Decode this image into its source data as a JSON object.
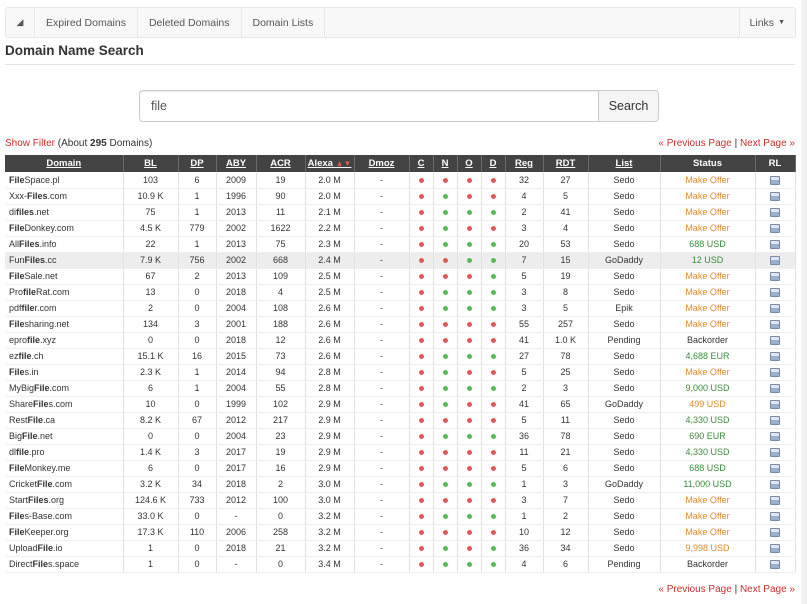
{
  "nav": {
    "home_icon": "home-icon",
    "links": [
      "Expired Domains",
      "Deleted Domains",
      "Domain Lists"
    ],
    "menu_label": "Links",
    "menu_caret": "▼"
  },
  "page_title": "Domain Name Search",
  "search": {
    "value": "file",
    "button": "Search"
  },
  "filter": {
    "show_filter": "Show Filter",
    "about_prefix": "(About",
    "count": "295",
    "about_suffix": "Domains)"
  },
  "pager": {
    "prev": "« Previous Page",
    "sep": "|",
    "next": "Next Page »"
  },
  "columns": [
    "Domain",
    "BL",
    "DP",
    "ABY",
    "ACR",
    "Alexa",
    "Dmoz",
    "C",
    "N",
    "O",
    "D",
    "Reg",
    "RDT",
    "List",
    "Status",
    "RL"
  ],
  "sort_indicator": "▲▼",
  "colors": {
    "header_bg": "#434343",
    "dot_red": "#e05b55",
    "dot_green": "#5cb85c",
    "status_orange": "#e08a2c",
    "status_green": "#3c8a3c",
    "link_red": "#c9302c"
  },
  "rows": [
    {
      "pre": "",
      "bold": "File",
      "post": "Space.pl",
      "bl": "103",
      "dp": "6",
      "aby": "2009",
      "acr": "19",
      "alexa": "2.0 M",
      "dmoz": "-",
      "c": "r",
      "n": "r",
      "o": "r",
      "d": "r",
      "reg": "32",
      "rdt": "27",
      "list": "Sedo",
      "status": "Make Offer",
      "sc": "orange"
    },
    {
      "pre": "Xxx-",
      "bold": "Files",
      "post": ".com",
      "bl": "10.9 K",
      "dp": "1",
      "aby": "1996",
      "acr": "90",
      "alexa": "2.0 M",
      "dmoz": "-",
      "c": "r",
      "n": "g",
      "o": "r",
      "d": "r",
      "reg": "4",
      "rdt": "5",
      "list": "Sedo",
      "status": "Make Offer",
      "sc": "orange"
    },
    {
      "pre": "di",
      "bold": "files",
      "post": ".net",
      "bl": "75",
      "dp": "1",
      "aby": "2013",
      "acr": "11",
      "alexa": "2.1 M",
      "dmoz": "-",
      "c": "r",
      "n": "g",
      "o": "g",
      "d": "g",
      "reg": "2",
      "rdt": "41",
      "list": "Sedo",
      "status": "Make Offer",
      "sc": "orange"
    },
    {
      "pre": "",
      "bold": "File",
      "post": "Donkey.com",
      "bl": "4.5 K",
      "dp": "779",
      "aby": "2002",
      "acr": "1622",
      "alexa": "2.2 M",
      "dmoz": "-",
      "c": "r",
      "n": "g",
      "o": "r",
      "d": "r",
      "reg": "3",
      "rdt": "4",
      "list": "Sedo",
      "status": "Make Offer",
      "sc": "orange"
    },
    {
      "pre": "All",
      "bold": "Files",
      "post": ".info",
      "bl": "22",
      "dp": "1",
      "aby": "2013",
      "acr": "75",
      "alexa": "2.3 M",
      "dmoz": "-",
      "c": "r",
      "n": "g",
      "o": "g",
      "d": "g",
      "reg": "20",
      "rdt": "53",
      "list": "Sedo",
      "status": "688 USD",
      "sc": "green"
    },
    {
      "pre": "Fun",
      "bold": "Files",
      "post": ".cc",
      "bl": "7.9 K",
      "dp": "756",
      "aby": "2002",
      "acr": "668",
      "alexa": "2.4 M",
      "dmoz": "-",
      "c": "r",
      "n": "r",
      "o": "g",
      "d": "g",
      "reg": "7",
      "rdt": "15",
      "list": "GoDaddy",
      "status": "12 USD",
      "sc": "green",
      "hl": true
    },
    {
      "pre": "",
      "bold": "File",
      "post": "Sale.net",
      "bl": "67",
      "dp": "2",
      "aby": "2013",
      "acr": "109",
      "alexa": "2.5 M",
      "dmoz": "-",
      "c": "r",
      "n": "r",
      "o": "r",
      "d": "g",
      "reg": "5",
      "rdt": "19",
      "list": "Sedo",
      "status": "Make Offer",
      "sc": "orange"
    },
    {
      "pre": "Pro",
      "bold": "file",
      "post": "Rat.com",
      "bl": "13",
      "dp": "0",
      "aby": "2018",
      "acr": "4",
      "alexa": "2.5 M",
      "dmoz": "-",
      "c": "r",
      "n": "g",
      "o": "g",
      "d": "g",
      "reg": "3",
      "rdt": "8",
      "list": "Sedo",
      "status": "Make Offer",
      "sc": "orange"
    },
    {
      "pre": "pdf",
      "bold": "file",
      "post": "r.com",
      "bl": "2",
      "dp": "0",
      "aby": "2004",
      "acr": "108",
      "alexa": "2.6 M",
      "dmoz": "-",
      "c": "r",
      "n": "g",
      "o": "g",
      "d": "g",
      "reg": "3",
      "rdt": "5",
      "list": "Epik",
      "status": "Make Offer",
      "sc": "orange"
    },
    {
      "pre": "",
      "bold": "File",
      "post": "sharing.net",
      "bl": "134",
      "dp": "3",
      "aby": "2001",
      "acr": "188",
      "alexa": "2.6 M",
      "dmoz": "-",
      "c": "r",
      "n": "r",
      "o": "r",
      "d": "r",
      "reg": "55",
      "rdt": "257",
      "list": "Sedo",
      "status": "Make Offer",
      "sc": "orange"
    },
    {
      "pre": "epro",
      "bold": "file",
      "post": ".xyz",
      "bl": "0",
      "dp": "0",
      "aby": "2018",
      "acr": "12",
      "alexa": "2.6 M",
      "dmoz": "-",
      "c": "r",
      "n": "r",
      "o": "r",
      "d": "r",
      "reg": "41",
      "rdt": "1.0 K",
      "list": "Pending",
      "status": "Backorder",
      "sc": "dark"
    },
    {
      "pre": "ez",
      "bold": "file",
      "post": ".ch",
      "bl": "15.1 K",
      "dp": "16",
      "aby": "2015",
      "acr": "73",
      "alexa": "2.6 M",
      "dmoz": "-",
      "c": "r",
      "n": "g",
      "o": "g",
      "d": "g",
      "reg": "27",
      "rdt": "78",
      "list": "Sedo",
      "status": "4,688 EUR",
      "sc": "green"
    },
    {
      "pre": "",
      "bold": "File",
      "post": "s.in",
      "bl": "2.3 K",
      "dp": "1",
      "aby": "2014",
      "acr": "94",
      "alexa": "2.8 M",
      "dmoz": "-",
      "c": "r",
      "n": "g",
      "o": "r",
      "d": "r",
      "reg": "5",
      "rdt": "25",
      "list": "Sedo",
      "status": "Make Offer",
      "sc": "orange"
    },
    {
      "pre": "MyBig",
      "bold": "File",
      "post": ".com",
      "bl": "6",
      "dp": "1",
      "aby": "2004",
      "acr": "55",
      "alexa": "2.8 M",
      "dmoz": "-",
      "c": "r",
      "n": "g",
      "o": "g",
      "d": "g",
      "reg": "2",
      "rdt": "3",
      "list": "Sedo",
      "status": "9,000 USD",
      "sc": "green"
    },
    {
      "pre": "Share",
      "bold": "File",
      "post": "s.com",
      "bl": "10",
      "dp": "0",
      "aby": "1999",
      "acr": "102",
      "alexa": "2.9 M",
      "dmoz": "-",
      "c": "r",
      "n": "g",
      "o": "r",
      "d": "r",
      "reg": "41",
      "rdt": "65",
      "list": "GoDaddy",
      "status": "499 USD",
      "sc": "orange"
    },
    {
      "pre": "Rest",
      "bold": "File",
      "post": ".ca",
      "bl": "8.2 K",
      "dp": "67",
      "aby": "2012",
      "acr": "217",
      "alexa": "2.9 M",
      "dmoz": "-",
      "c": "r",
      "n": "r",
      "o": "r",
      "d": "r",
      "reg": "5",
      "rdt": "11",
      "list": "Sedo",
      "status": "4,330 USD",
      "sc": "green"
    },
    {
      "pre": "Big",
      "bold": "File",
      "post": ".net",
      "bl": "0",
      "dp": "0",
      "aby": "2004",
      "acr": "23",
      "alexa": "2.9 M",
      "dmoz": "-",
      "c": "r",
      "n": "g",
      "o": "g",
      "d": "g",
      "reg": "36",
      "rdt": "78",
      "list": "Sedo",
      "status": "690 EUR",
      "sc": "green"
    },
    {
      "pre": "dl",
      "bold": "file",
      "post": ".pro",
      "bl": "1.4 K",
      "dp": "3",
      "aby": "2017",
      "acr": "19",
      "alexa": "2.9 M",
      "dmoz": "-",
      "c": "r",
      "n": "r",
      "o": "r",
      "d": "r",
      "reg": "11",
      "rdt": "21",
      "list": "Sedo",
      "status": "4,330 USD",
      "sc": "green"
    },
    {
      "pre": "",
      "bold": "File",
      "post": "Monkey.me",
      "bl": "6",
      "dp": "0",
      "aby": "2017",
      "acr": "16",
      "alexa": "2.9 M",
      "dmoz": "-",
      "c": "r",
      "n": "r",
      "o": "r",
      "d": "r",
      "reg": "5",
      "rdt": "6",
      "list": "Sedo",
      "status": "688 USD",
      "sc": "green"
    },
    {
      "pre": "Cricket",
      "bold": "File",
      "post": ".com",
      "bl": "3.2 K",
      "dp": "34",
      "aby": "2018",
      "acr": "2",
      "alexa": "3.0 M",
      "dmoz": "-",
      "c": "r",
      "n": "g",
      "o": "g",
      "d": "g",
      "reg": "1",
      "rdt": "3",
      "list": "GoDaddy",
      "status": "11,000 USD",
      "sc": "green"
    },
    {
      "pre": "Start",
      "bold": "Files",
      "post": ".org",
      "bl": "124.6 K",
      "dp": "733",
      "aby": "2012",
      "acr": "100",
      "alexa": "3.0 M",
      "dmoz": "-",
      "c": "r",
      "n": "r",
      "o": "r",
      "d": "r",
      "reg": "3",
      "rdt": "7",
      "list": "Sedo",
      "status": "Make Offer",
      "sc": "orange"
    },
    {
      "pre": "",
      "bold": "File",
      "post": "s-Base.com",
      "bl": "33.0 K",
      "dp": "0",
      "aby": "-",
      "acr": "0",
      "alexa": "3.2 M",
      "dmoz": "-",
      "c": "r",
      "n": "g",
      "o": "g",
      "d": "g",
      "reg": "1",
      "rdt": "2",
      "list": "Sedo",
      "status": "Make Offer",
      "sc": "orange"
    },
    {
      "pre": "",
      "bold": "File",
      "post": "Keeper.org",
      "bl": "17.3 K",
      "dp": "110",
      "aby": "2006",
      "acr": "258",
      "alexa": "3.2 M",
      "dmoz": "-",
      "c": "r",
      "n": "r",
      "o": "r",
      "d": "r",
      "reg": "10",
      "rdt": "12",
      "list": "Sedo",
      "status": "Make Offer",
      "sc": "orange"
    },
    {
      "pre": "Upload",
      "bold": "File",
      "post": ".io",
      "bl": "1",
      "dp": "0",
      "aby": "2018",
      "acr": "21",
      "alexa": "3.2 M",
      "dmoz": "-",
      "c": "r",
      "n": "g",
      "o": "r",
      "d": "g",
      "reg": "36",
      "rdt": "34",
      "list": "Sedo",
      "status": "9,998 USD",
      "sc": "orange"
    },
    {
      "pre": "Direct",
      "bold": "File",
      "post": "s.space",
      "bl": "1",
      "dp": "0",
      "aby": "-",
      "acr": "0",
      "alexa": "3.4 M",
      "dmoz": "-",
      "c": "r",
      "n": "g",
      "o": "g",
      "d": "g",
      "reg": "4",
      "rdt": "6",
      "list": "Pending",
      "status": "Backorder",
      "sc": "dark"
    }
  ]
}
